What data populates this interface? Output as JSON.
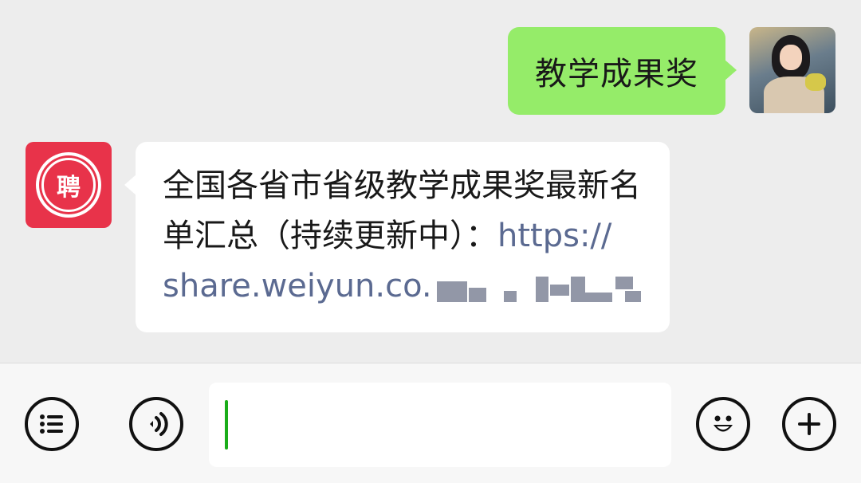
{
  "messages": {
    "outgoing": {
      "text": "教学成果奖"
    },
    "incoming": {
      "line1": "全国各省市省级教学成果奖最新名",
      "line2": "单汇总（持续更新中）：",
      "link_start": "https://",
      "link_rest": "share.weiyun.co."
    }
  },
  "avatars": {
    "org_glyph": "聘"
  },
  "input_bar": {
    "input_value": "",
    "icons": [
      "list-icon",
      "voice-icon",
      "emoji-icon",
      "plus-icon"
    ]
  },
  "colors": {
    "outgoing_bubble": "#95ec69",
    "incoming_bubble": "#ffffff",
    "link": "#5b6a91",
    "org_avatar": "#e8334a",
    "caret": "#1aad19"
  }
}
